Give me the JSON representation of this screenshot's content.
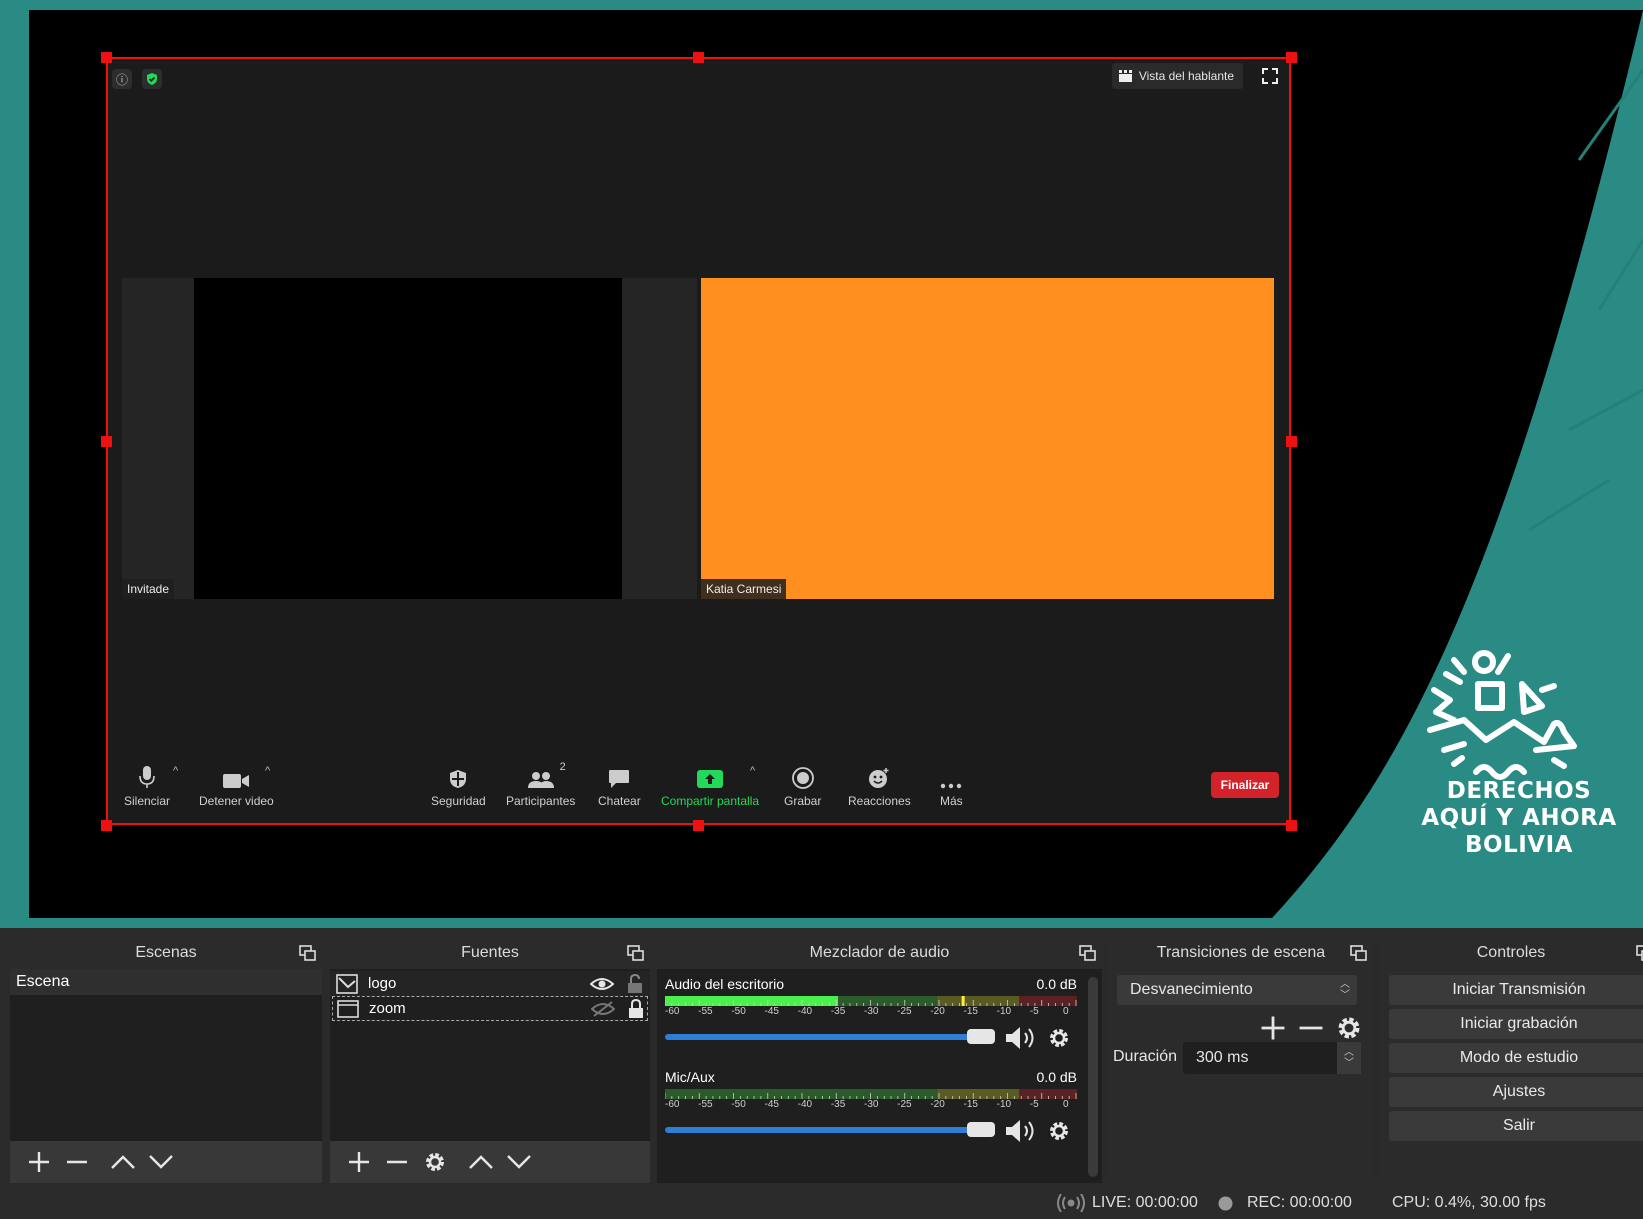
{
  "zoom": {
    "speaker_view_label": "Vista del hablante",
    "participants": [
      {
        "name": "Invitade"
      },
      {
        "name": "Katia Carmesi"
      }
    ],
    "toolbar": {
      "mute": "Silenciar",
      "stop_video": "Detener video",
      "security": "Seguridad",
      "participants": "Participantes",
      "participants_count": "2",
      "chat": "Chatear",
      "share_screen": "Compartir pantalla",
      "record": "Grabar",
      "reactions": "Reacciones",
      "more": "Más",
      "end": "Finalizar"
    },
    "colors": {
      "share_green": "#23d959",
      "end_red": "#d4222a",
      "tile_orange": "#ff8f1f"
    }
  },
  "overlay": {
    "brand_lines": [
      "DERECHOS",
      "AQUÍ Y AHORA",
      "BOLIVIA"
    ],
    "accent_teal": "#2a8a84"
  },
  "selection": {
    "color": "#ee1111"
  },
  "docks": {
    "scenes": {
      "title": "Escenas",
      "items": [
        "Escena"
      ]
    },
    "sources": {
      "title": "Fuentes",
      "items": [
        {
          "name": "logo",
          "icon": "image-icon",
          "visible": true
        },
        {
          "name": "zoom",
          "icon": "window-capture-icon",
          "visible": false
        }
      ]
    },
    "mixer": {
      "title": "Mezclador de audio",
      "scale": [
        "-60",
        "-55",
        "-50",
        "-45",
        "-40",
        "-35",
        "-30",
        "-25",
        "-20",
        "-15",
        "-10",
        "-5",
        "0"
      ],
      "channels": [
        {
          "name": "Audio del escritorio",
          "db": "0.0 dB",
          "level": 0.42
        },
        {
          "name": "Mic/Aux",
          "db": "0.0 dB",
          "level": 0.0
        }
      ]
    },
    "transitions": {
      "title": "Transiciones de escena",
      "selected": "Desvanecimiento",
      "duration_label": "Duración",
      "duration_value": "300 ms"
    },
    "controls": {
      "title": "Controles",
      "buttons": [
        "Iniciar Transmisión",
        "Iniciar grabación",
        "Modo de estudio",
        "Ajustes",
        "Salir"
      ]
    }
  },
  "status": {
    "live": "LIVE: 00:00:00",
    "rec": "REC: 00:00:00",
    "cpu": "CPU: 0.4%, 30.00 fps"
  }
}
